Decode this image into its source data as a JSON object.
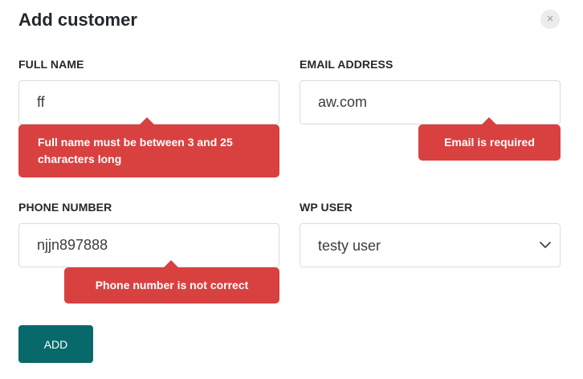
{
  "modal": {
    "title": "Add customer",
    "close_icon": "close-icon",
    "close_glyph": "×"
  },
  "fields": {
    "full_name": {
      "label": "FULL NAME",
      "value": "ff",
      "error": "Full name must be between 3 and 25 characters long"
    },
    "email": {
      "label": "EMAIL ADDRESS",
      "value": "aw.com",
      "error": "Email is required"
    },
    "phone": {
      "label": "PHONE NUMBER",
      "value": "njjn897888",
      "error": "Phone number is not correct"
    },
    "wp_user": {
      "label": "WP USER",
      "selected": "testy user",
      "icon": "chevron-down-icon"
    }
  },
  "actions": {
    "add_label": "ADD"
  },
  "colors": {
    "error": "#d94141",
    "primary": "#08696b",
    "border": "#dcdcdc"
  }
}
